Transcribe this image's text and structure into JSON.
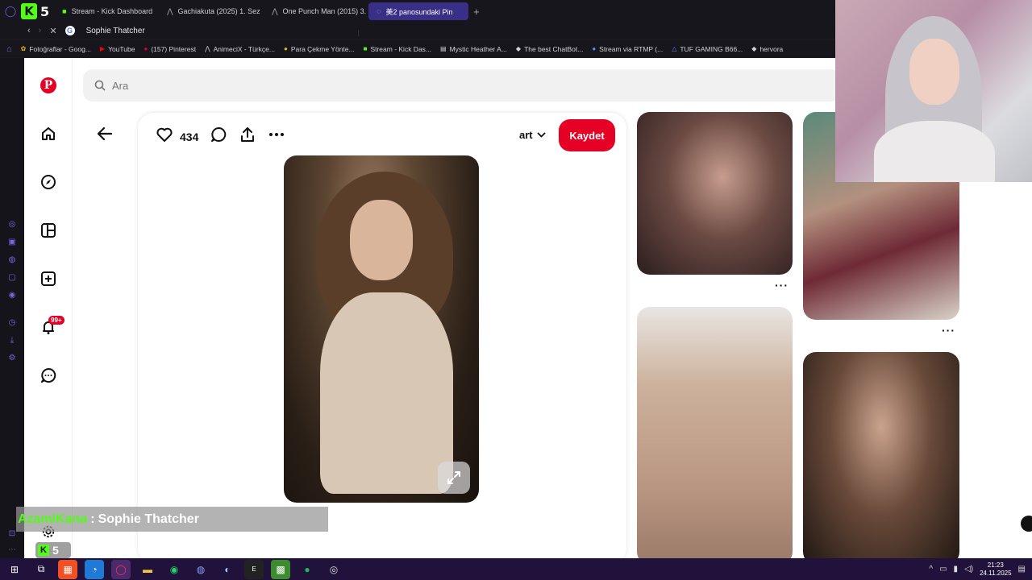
{
  "browser": {
    "workspace_number": "5",
    "tabs": [
      {
        "label": "Stream - Kick Dashboard",
        "icon": "kick-icon"
      },
      {
        "label": "Gachiakuta (2025) 1. Sez",
        "icon": "animecix-icon"
      },
      {
        "label": "One Punch Man (2015) 3.",
        "icon": "animecix-icon"
      },
      {
        "label": "美2 panosundaki Pin",
        "icon": "loading-icon",
        "active": true
      }
    ],
    "address": "Sophie Thatcher",
    "bookmarks": [
      {
        "label": "Fotoğraflar - Goog...",
        "icon": "google-photos-icon"
      },
      {
        "label": "YouTube",
        "icon": "youtube-icon"
      },
      {
        "label": "(157) Pinterest",
        "icon": "pinterest-icon"
      },
      {
        "label": "AnimeciX - Türkçe...",
        "icon": "animecix-icon"
      },
      {
        "label": "Para Çekme Yönte...",
        "icon": "coin-icon"
      },
      {
        "label": "Stream - Kick Das...",
        "icon": "kick-icon"
      },
      {
        "label": "Mystic Heather A...",
        "icon": "shop-icon"
      },
      {
        "label": "The best ChatBot...",
        "icon": "chatbot-icon"
      },
      {
        "label": "Stream via RTMP (...",
        "icon": "rtmp-icon"
      },
      {
        "label": "TUF GAMING B66...",
        "icon": "tuf-icon"
      },
      {
        "label": "hervora",
        "icon": "diamond-icon"
      }
    ]
  },
  "pinterest": {
    "search_placeholder": "Ara",
    "pin": {
      "likes": "434",
      "board": "art",
      "save_label": "Kaydet"
    },
    "notification_badge": "99+"
  },
  "chat": {
    "user": "AzamiKana",
    "separator": ":",
    "message": "Sophie Thatcher",
    "kick_count": "5"
  },
  "taskbar": {
    "time": "21:23",
    "date": "24.11.2025"
  },
  "colors": {
    "pinterest_red": "#e60023",
    "kick_green": "#53fc18",
    "opera_purple": "#3a2f86",
    "taskbar": "#20123a"
  }
}
